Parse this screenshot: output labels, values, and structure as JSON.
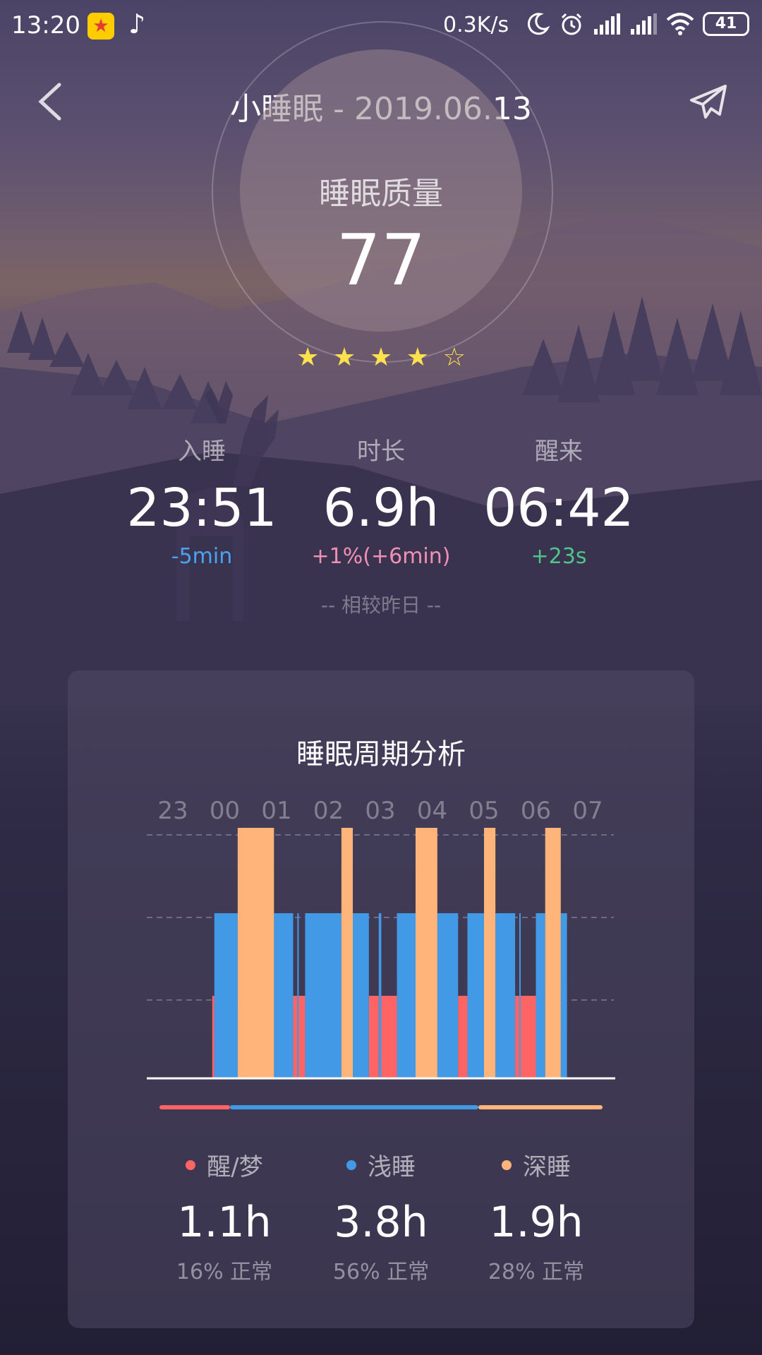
{
  "status_bar": {
    "time": "13:20",
    "net_speed": "0.3K/s",
    "battery": "41",
    "icons": [
      "qq-icon",
      "music-note-icon",
      "moon-icon",
      "alarm-icon",
      "signal-icon",
      "signal-icon",
      "wifi-icon",
      "battery-icon"
    ]
  },
  "header": {
    "title": "小睡眠 - 2019.06.13",
    "back_icon": "chevron-left-icon",
    "share_icon": "paper-plane-icon"
  },
  "quality": {
    "label": "睡眠质量",
    "score": "77",
    "rating": 4,
    "rating_max": 5
  },
  "stats": {
    "sleep": {
      "label": "入睡",
      "value": "23:51",
      "delta": "-5min",
      "delta_color": "#4aa3f0"
    },
    "duration": {
      "label": "时长",
      "value": "6.9h",
      "delta": "+1%(+6min)",
      "delta_color": "#f28fb5"
    },
    "wake": {
      "label": "醒来",
      "value": "06:42",
      "delta": "+23s",
      "delta_color": "#4fc48a"
    },
    "compare_note": "-- 相较昨日 --"
  },
  "cycle": {
    "title": "睡眠周期分析",
    "stage_colors": {
      "awake": "#ff6464",
      "light": "#4299e6",
      "deep": "#ffb57a"
    },
    "legend": {
      "awake": {
        "label": "醒/梦",
        "hours": "1.1h",
        "pct": "16% 正常",
        "fraction": 0.16
      },
      "light": {
        "label": "浅睡",
        "hours": "3.8h",
        "pct": "56% 正常",
        "fraction": 0.56
      },
      "deep": {
        "label": "深睡",
        "hours": "1.9h",
        "pct": "28% 正常",
        "fraction": 0.28
      }
    }
  },
  "chart_data": {
    "type": "bar",
    "title": "睡眠周期分析",
    "x_ticks": [
      "23",
      "00",
      "01",
      "02",
      "03",
      "04",
      "05",
      "06",
      "07"
    ],
    "x_range": [
      23.0,
      31.0
    ],
    "levels": {
      "awake": 1,
      "light": 2,
      "deep": 3
    },
    "grid": true,
    "segments": [
      {
        "start": 23.76,
        "end": 23.8,
        "stage": "awake"
      },
      {
        "start": 23.8,
        "end": 24.25,
        "stage": "light"
      },
      {
        "start": 24.25,
        "end": 24.95,
        "stage": "deep"
      },
      {
        "start": 24.95,
        "end": 25.32,
        "stage": "light"
      },
      {
        "start": 25.32,
        "end": 25.4,
        "stage": "awake"
      },
      {
        "start": 25.4,
        "end": 25.42,
        "stage": "light"
      },
      {
        "start": 25.42,
        "end": 25.55,
        "stage": "awake"
      },
      {
        "start": 25.55,
        "end": 26.25,
        "stage": "light"
      },
      {
        "start": 26.25,
        "end": 26.47,
        "stage": "deep"
      },
      {
        "start": 26.47,
        "end": 26.78,
        "stage": "light"
      },
      {
        "start": 26.78,
        "end": 26.97,
        "stage": "awake"
      },
      {
        "start": 26.97,
        "end": 27.02,
        "stage": "light"
      },
      {
        "start": 27.02,
        "end": 27.32,
        "stage": "awake"
      },
      {
        "start": 27.32,
        "end": 27.68,
        "stage": "light"
      },
      {
        "start": 27.68,
        "end": 28.1,
        "stage": "deep"
      },
      {
        "start": 28.1,
        "end": 28.5,
        "stage": "light"
      },
      {
        "start": 28.5,
        "end": 28.68,
        "stage": "awake"
      },
      {
        "start": 28.68,
        "end": 29.0,
        "stage": "light"
      },
      {
        "start": 29.0,
        "end": 29.22,
        "stage": "deep"
      },
      {
        "start": 29.22,
        "end": 29.6,
        "stage": "light"
      },
      {
        "start": 29.6,
        "end": 29.68,
        "stage": "awake"
      },
      {
        "start": 29.68,
        "end": 29.7,
        "stage": "light"
      },
      {
        "start": 29.7,
        "end": 30.0,
        "stage": "awake"
      },
      {
        "start": 30.0,
        "end": 30.18,
        "stage": "light"
      },
      {
        "start": 30.18,
        "end": 30.48,
        "stage": "deep"
      },
      {
        "start": 30.48,
        "end": 30.6,
        "stage": "light"
      }
    ]
  }
}
